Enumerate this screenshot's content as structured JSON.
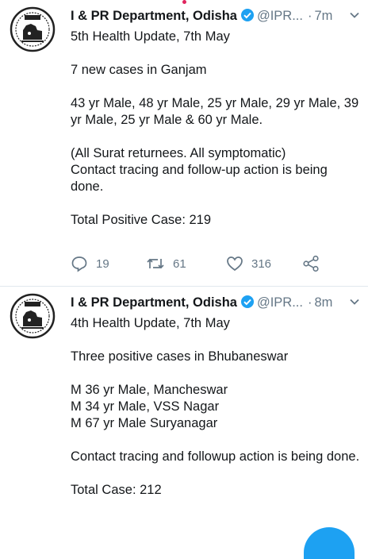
{
  "tweets": [
    {
      "name": "I & PR Department, Odisha",
      "handle": "@IPR...",
      "time": "7m",
      "lines": [
        "5th Health Update, 7th May",
        "7 new cases in Ganjam",
        "43 yr Male, 48 yr Male, 25 yr Male, 29 yr Male, 39 yr Male, 25 yr Male & 60 yr Male.",
        "(All Surat returnees. All symptomatic)\nContact tracing and follow-up action is being done.",
        "Total Positive Case: 219"
      ],
      "actions": {
        "replies": "19",
        "retweets": "61",
        "likes": "316"
      }
    },
    {
      "name": "I & PR Department, Odisha",
      "handle": "@IPR...",
      "time": "8m",
      "lines": [
        "4th Health Update, 7th May",
        "Three positive cases in Bhubaneswar",
        "M 36 yr Male, Mancheswar\nM 34 yr Male, VSS Nagar\nM 67 yr Male Suryanagar",
        "Contact tracing and followup action is being done.",
        "Total Case: 212"
      ]
    }
  ],
  "colors": {
    "verified": "#1da1f2",
    "muted": "#657786",
    "text": "#14171a",
    "notification_dot": "#e0245e"
  },
  "icons": [
    "verified-badge-icon",
    "chevron-down-icon",
    "reply-icon",
    "retweet-icon",
    "like-icon",
    "share-icon",
    "odisha-emblem"
  ]
}
